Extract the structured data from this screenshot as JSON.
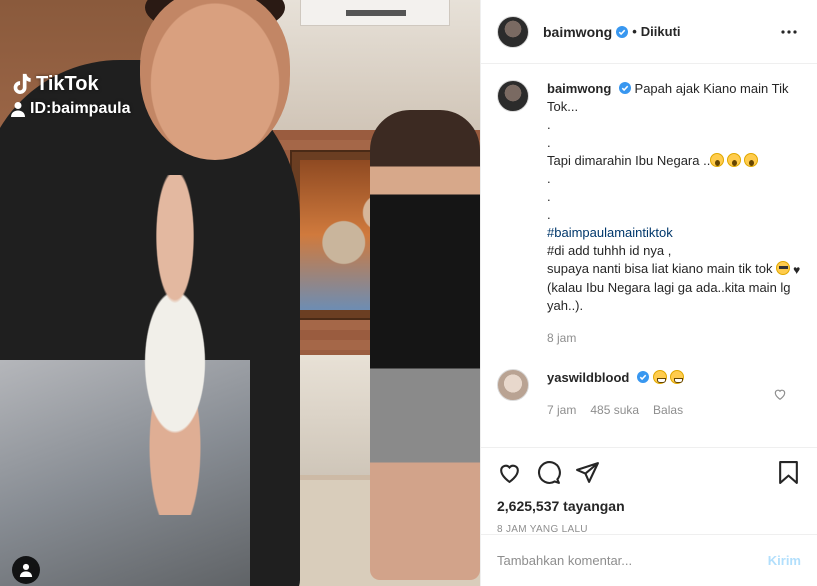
{
  "media": {
    "watermark_brand": "TikTok",
    "watermark_id": "ID:baimpaula"
  },
  "header": {
    "username": "baimwong",
    "separator": "•",
    "follow_label": "Diikuti"
  },
  "caption": {
    "username": "baimwong",
    "lines": [
      "Papah ajak Kiano main Tik Tok...",
      ".",
      ".",
      "Tapi dimarahin Ibu Negara ..",
      ".",
      ".",
      "."
    ],
    "hashtag": "#baimpaulamaintiktok",
    "line_add": "#di add tuhhh id nya ,",
    "line_supaya": "supaya nanti bisa liat kiano main tik tok",
    "line_kalau": "(kalau Ibu Negara lagi ga ada..kita main lg yah..).",
    "time": "8 jam"
  },
  "reply": {
    "username": "yaswildblood",
    "time": "7 jam",
    "likes": "485 suka",
    "reply_label": "Balas"
  },
  "stats": {
    "views": "2,625,537 tayangan",
    "posted": "8 JAM YANG LALU"
  },
  "composer": {
    "placeholder": "Tambahkan komentar...",
    "post_label": "Kirim"
  },
  "colors": {
    "verified": "#3897f0",
    "link": "#00376b",
    "post_disabled": "#b2dffc"
  }
}
